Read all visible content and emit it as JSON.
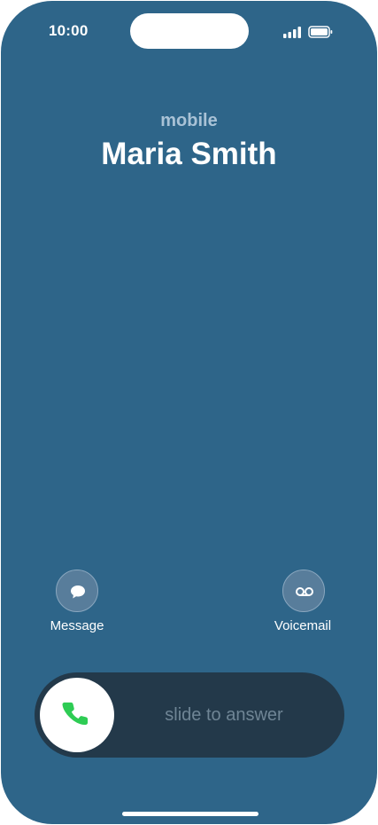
{
  "status_bar": {
    "time": "10:00",
    "signal_icon": "cellular-signal-icon",
    "battery_icon": "battery-icon"
  },
  "call": {
    "subtitle": "mobile",
    "name": "Maria Smith"
  },
  "actions": {
    "message_label": "Message",
    "message_icon": "message-bubble-icon",
    "voicemail_label": "Voicemail",
    "voicemail_icon": "voicemail-icon"
  },
  "answer": {
    "slider_text": "slide to answer",
    "phone_icon": "phone-icon"
  },
  "colors": {
    "background": "#2e6589",
    "slider": "#23394a",
    "accent_green": "#2ecc54"
  }
}
